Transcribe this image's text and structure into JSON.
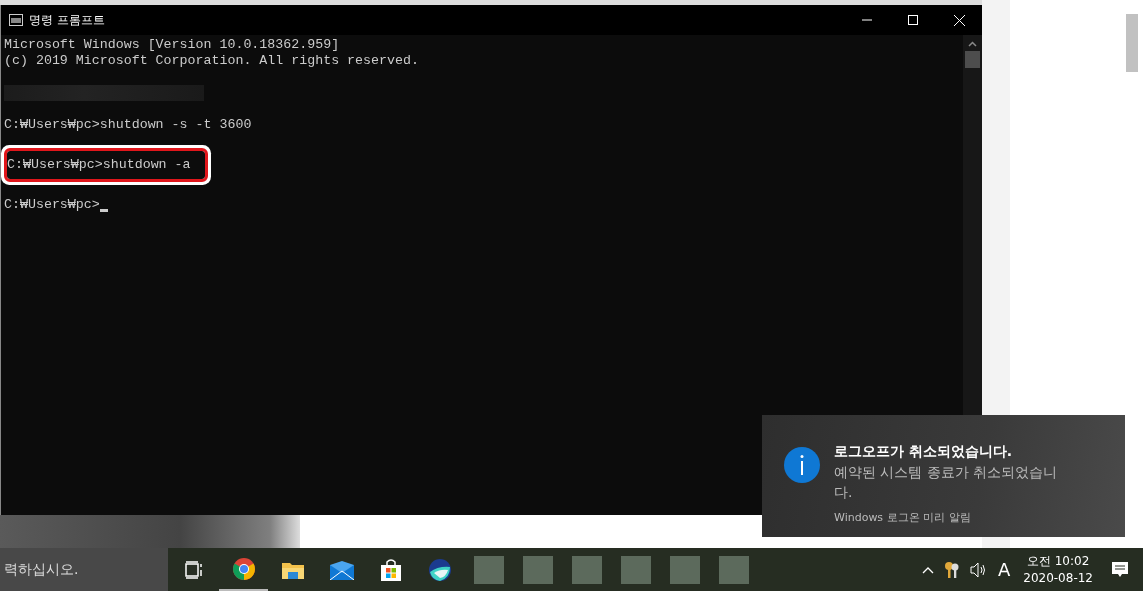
{
  "window": {
    "title": "명령 프롬프트"
  },
  "console": {
    "lines": [
      {
        "kind": "text",
        "text": "Microsoft Windows [Version 10.0.18362.959]",
        "highlighted": false
      },
      {
        "kind": "text",
        "text": "(c) 2019 Microsoft Corporation. All rights reserved.",
        "highlighted": false
      },
      {
        "kind": "blank"
      },
      {
        "kind": "redacted"
      },
      {
        "kind": "blank"
      },
      {
        "kind": "text",
        "text": "C:₩Users₩pc>shutdown -s -t 3600",
        "highlighted": false
      },
      {
        "kind": "blank"
      },
      {
        "kind": "text",
        "text": "C:₩Users₩pc>shutdown -a",
        "highlighted": true
      },
      {
        "kind": "blank"
      },
      {
        "kind": "prompt",
        "text": "C:₩Users₩pc>",
        "cursor": true
      }
    ]
  },
  "notification": {
    "title": "로그오프가 취소되었습니다.",
    "body": "예약된 시스템 종료가 취소되었습니\n다.",
    "source": "Windows 로그온 미리 알림"
  },
  "taskbar": {
    "search_text": "력하십시오.",
    "apps": [
      {
        "kind": "taskview",
        "running": false
      },
      {
        "kind": "chrome",
        "running": true
      },
      {
        "kind": "explorer",
        "running": false
      },
      {
        "kind": "mail",
        "running": false
      },
      {
        "kind": "store",
        "running": false
      },
      {
        "kind": "whale",
        "running": false
      },
      {
        "kind": "blurred",
        "running": false
      },
      {
        "kind": "blurred",
        "running": false
      },
      {
        "kind": "blurred",
        "running": false
      },
      {
        "kind": "blurred",
        "running": false
      },
      {
        "kind": "blurred",
        "running": false
      },
      {
        "kind": "blurred",
        "running": false
      }
    ],
    "tray": {
      "input_indicator": "A",
      "time": "오전 10:02",
      "date": "2020-08-12"
    }
  }
}
